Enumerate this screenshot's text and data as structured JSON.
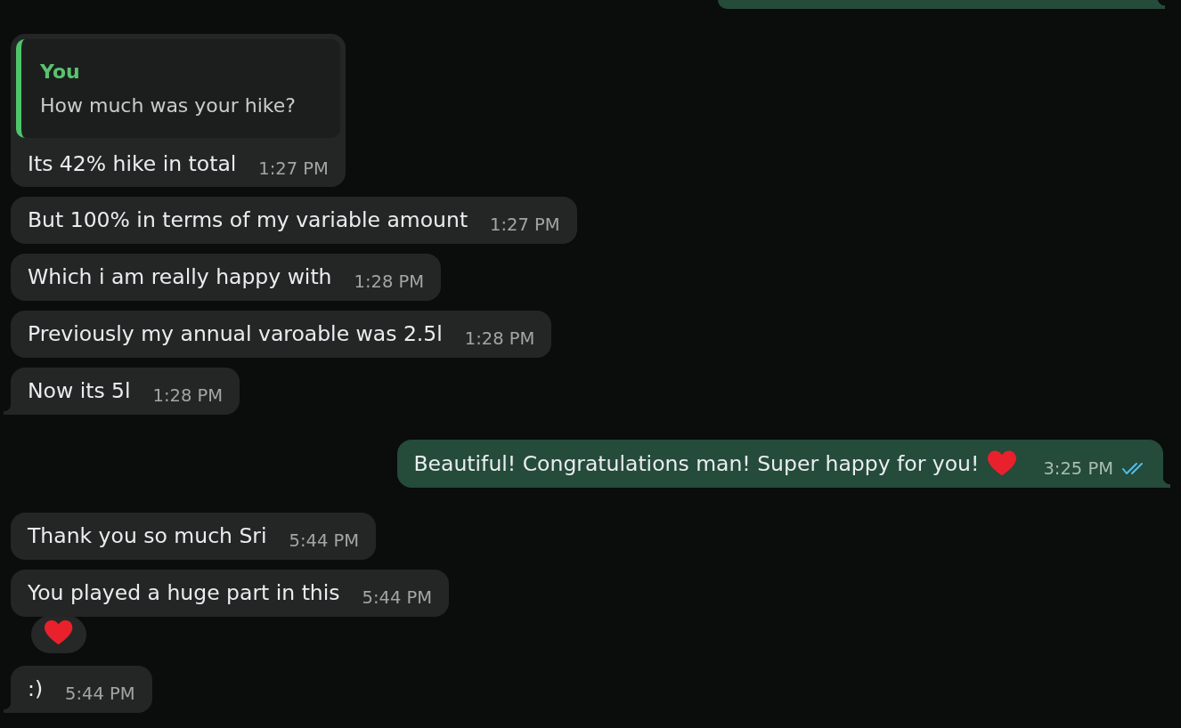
{
  "messages": [
    {
      "kind": "outgoing-cut",
      "tail": true
    },
    {
      "kind": "incoming",
      "reply": {
        "author": "You",
        "text": "How much was your hike?"
      },
      "text": "Its 42% hike in total",
      "time": "1:27 PM",
      "tail": false
    },
    {
      "kind": "incoming",
      "text": "But 100% in terms of my variable amount",
      "time": "1:27 PM",
      "tail": false
    },
    {
      "kind": "incoming",
      "text": "Which i am really happy with",
      "time": "1:28 PM",
      "tail": false
    },
    {
      "kind": "incoming",
      "text": "Previously my annual varoable was 2.5l",
      "time": "1:28 PM",
      "tail": false
    },
    {
      "kind": "incoming",
      "text": "Now its 5l",
      "time": "1:28 PM",
      "tail": true
    },
    {
      "kind": "outgoing",
      "text": "Beautiful! Congratulations man! Super happy for you!",
      "emoji": true,
      "time": "3:25 PM",
      "read": true,
      "tail": true
    },
    {
      "kind": "incoming",
      "text": "Thank you so much Sri",
      "time": "5:44 PM",
      "tail": false
    },
    {
      "kind": "incoming",
      "text": "You played a huge part in this",
      "time": "5:44 PM",
      "tail": false,
      "reacted": true
    },
    {
      "kind": "incoming",
      "text": ":)",
      "time": "5:44 PM",
      "tail": true
    }
  ]
}
